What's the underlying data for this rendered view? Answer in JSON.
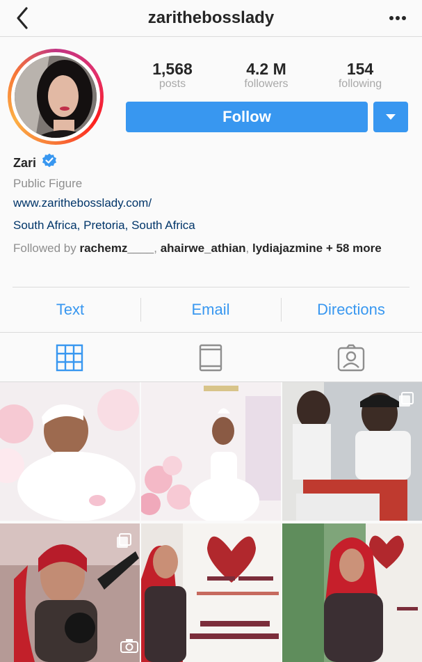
{
  "header": {
    "username": "zarithebosslady"
  },
  "profile": {
    "stats": [
      {
        "value": "1,568",
        "label": "posts"
      },
      {
        "value": "4.2 M",
        "label": "followers"
      },
      {
        "value": "154",
        "label": "following"
      }
    ],
    "follow_label": "Follow",
    "name": "Zari",
    "category": "Public Figure",
    "website": "www.zarithebosslady.com/",
    "address": "South Africa, Pretoria, South Africa",
    "followed_by": {
      "prefix": "Followed by",
      "user1": "rachemz____",
      "user2": "ahairwe_athian",
      "user3": "lydiajazmine",
      "rest": "+ 58 more"
    }
  },
  "contact": {
    "text_label": "Text",
    "email_label": "Email",
    "directions_label": "Directions"
  },
  "colors": {
    "accent": "#3897f0",
    "link": "#003569"
  },
  "posts_grid": {
    "icons": [
      "grid-icon",
      "igtv-icon",
      "tagged-icon"
    ]
  }
}
